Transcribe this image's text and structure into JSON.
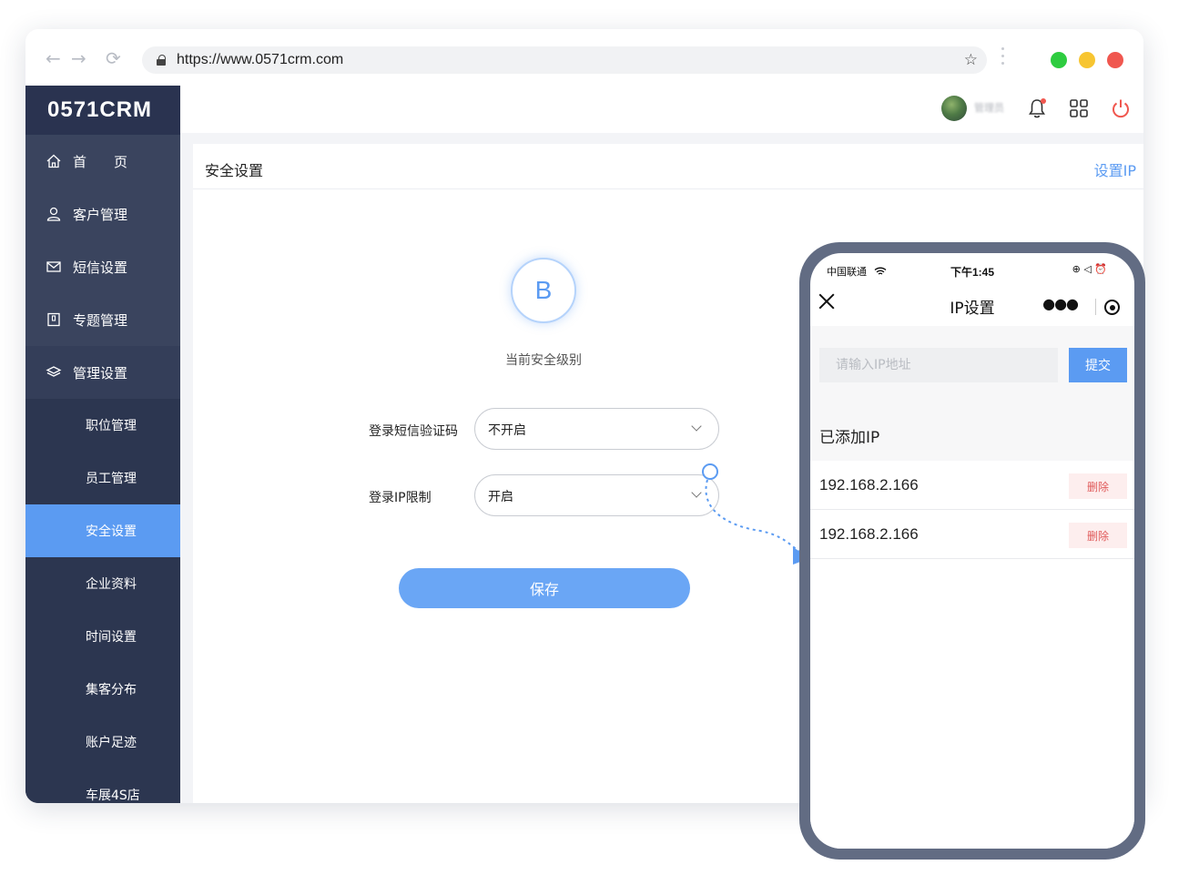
{
  "browser": {
    "url": "https://www.0571crm.com",
    "back": "←",
    "forward": "→",
    "reload": "⟳",
    "star": "☆"
  },
  "sidebar": {
    "logo": "0571CRM",
    "menu": [
      {
        "label": "首　　页",
        "icon": "home-icon"
      },
      {
        "label": "客户管理",
        "icon": "user-icon"
      },
      {
        "label": "短信设置",
        "icon": "mail-icon"
      },
      {
        "label": "专题管理",
        "icon": "book-icon"
      },
      {
        "label": "管理设置",
        "icon": "layers-icon"
      }
    ],
    "submenu": [
      "职位管理",
      "员工管理",
      "安全设置",
      "企业资料",
      "时间设置",
      "集客分布",
      "账户足迹",
      "车展4S店"
    ],
    "active_sub": "安全设置"
  },
  "topbar": {
    "user_name": "管理员"
  },
  "content": {
    "title": "安全设置",
    "set_ip_link": "设置IP",
    "level_letter": "B",
    "level_label": "当前安全级别",
    "sms_label": "登录短信验证码",
    "sms_value": "不开启",
    "ip_label": "登录IP限制",
    "ip_value": "开启",
    "save_label": "保存"
  },
  "phone": {
    "carrier": "中国联通",
    "time": "下午1:45",
    "status_icons": "⊕ ◁ ⏰",
    "title": "IP设置",
    "input_placeholder": "请输入IP地址",
    "submit_label": "提交",
    "added_title": "已添加IP",
    "ips": [
      {
        "ip": "192.168.2.166",
        "delete_label": "删除"
      },
      {
        "ip": "192.168.2.166",
        "delete_label": "删除"
      }
    ]
  },
  "colors": {
    "accent": "#5b9bf2",
    "sidebar_bg": "#2c3650",
    "danger": "#e05a5a",
    "traffic_green": "#2ecc40",
    "traffic_yellow": "#f7c531",
    "traffic_red": "#f0574f"
  }
}
